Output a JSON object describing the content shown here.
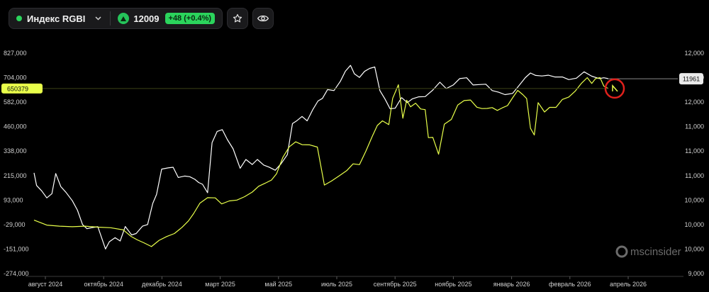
{
  "header": {
    "index_name": "Индекс RGBI",
    "price": "12009",
    "change": "+48 (+0.4%)",
    "status_color": "#2bd45c"
  },
  "icons": {
    "dropdown": "chevron-down-icon",
    "trend": "arrow-up-icon",
    "favorite": "star-icon",
    "visibility": "eye-icon"
  },
  "watermark": "mscinsider",
  "chart_data": {
    "type": "line",
    "x_labels": [
      "август 2024",
      "октябрь 2024",
      "декабрь 2024",
      "март 2025",
      "май 2025",
      "июль 2025",
      "сентябрь 2025",
      "ноябрь 2025",
      "январь 2026",
      "февраль 2026",
      "апрель 2026"
    ],
    "y_left_ticks": [
      "827,000",
      "704,000",
      "582,000",
      "460,000",
      "338,000",
      "215,000",
      "93,000",
      "-29,000",
      "-151,000",
      "-274,000"
    ],
    "y_left_range": [
      -274000,
      827000
    ],
    "y_right_ticks": [
      "12,000",
      "12,000",
      "12,000",
      "11,000",
      "11,000",
      "11,000",
      "10,000",
      "10,000",
      "10,000",
      "9,000"
    ],
    "y_right_range": [
      9000,
      12800
    ],
    "last_value_left": "650379",
    "last_value_right": "11961",
    "series": [
      {
        "color": "#ffffff",
        "axis": "left",
        "points": [
          [
            0,
            229000
          ],
          [
            0.004,
            166000
          ],
          [
            0.012,
            139000
          ],
          [
            0.02,
            104000
          ],
          [
            0.028,
            125000
          ],
          [
            0.034,
            226000
          ],
          [
            0.042,
            160000
          ],
          [
            0.05,
            132000
          ],
          [
            0.06,
            90000
          ],
          [
            0.068,
            43000
          ],
          [
            0.076,
            -29000
          ],
          [
            0.083,
            -50000
          ],
          [
            0.09,
            -45000
          ],
          [
            0.1,
            -40000
          ],
          [
            0.112,
            -151000
          ],
          [
            0.118,
            -115000
          ],
          [
            0.127,
            -95000
          ],
          [
            0.135,
            -111000
          ],
          [
            0.143,
            -39000
          ],
          [
            0.153,
            -81000
          ],
          [
            0.16,
            -74000
          ],
          [
            0.17,
            -37000
          ],
          [
            0.178,
            -29000
          ],
          [
            0.186,
            76000
          ],
          [
            0.192,
            121000
          ],
          [
            0.2,
            248000
          ],
          [
            0.21,
            254000
          ],
          [
            0.218,
            257000
          ],
          [
            0.226,
            206000
          ],
          [
            0.236,
            213000
          ],
          [
            0.244,
            210000
          ],
          [
            0.252,
            197000
          ],
          [
            0.258,
            181000
          ],
          [
            0.264,
            172000
          ],
          [
            0.272,
            130000
          ],
          [
            0.279,
            380000
          ],
          [
            0.287,
            436000
          ],
          [
            0.295,
            445000
          ],
          [
            0.303,
            395000
          ],
          [
            0.312,
            349000
          ],
          [
            0.323,
            252000
          ],
          [
            0.332,
            296000
          ],
          [
            0.342,
            271000
          ],
          [
            0.35,
            296000
          ],
          [
            0.36,
            268000
          ],
          [
            0.368,
            258000
          ],
          [
            0.378,
            242000
          ],
          [
            0.387,
            274000
          ],
          [
            0.397,
            320000
          ],
          [
            0.405,
            475000
          ],
          [
            0.412,
            490000
          ],
          [
            0.42,
            511000
          ],
          [
            0.428,
            489000
          ],
          [
            0.437,
            546000
          ],
          [
            0.445,
            588000
          ],
          [
            0.452,
            601000
          ],
          [
            0.46,
            645000
          ],
          [
            0.47,
            640000
          ],
          [
            0.48,
            686000
          ],
          [
            0.488,
            737000
          ],
          [
            0.496,
            766000
          ],
          [
            0.502,
            724000
          ],
          [
            0.51,
            706000
          ],
          [
            0.518,
            736000
          ],
          [
            0.526,
            751000
          ],
          [
            0.534,
            758000
          ],
          [
            0.542,
            640000
          ],
          [
            0.55,
            598000
          ],
          [
            0.558,
            549000
          ],
          [
            0.566,
            552000
          ],
          [
            0.576,
            605000
          ],
          [
            0.585,
            580000
          ],
          [
            0.593,
            599000
          ],
          [
            0.603,
            609000
          ],
          [
            0.613,
            610000
          ],
          [
            0.625,
            643000
          ],
          [
            0.636,
            682000
          ],
          [
            0.646,
            650000
          ],
          [
            0.657,
            668000
          ],
          [
            0.667,
            700000
          ],
          [
            0.678,
            704000
          ],
          [
            0.688,
            668000
          ],
          [
            0.698,
            670000
          ],
          [
            0.708,
            672000
          ],
          [
            0.718,
            640000
          ],
          [
            0.728,
            632000
          ],
          [
            0.738,
            620000
          ],
          [
            0.75,
            626000
          ],
          [
            0.76,
            665000
          ],
          [
            0.77,
            705000
          ],
          [
            0.778,
            728000
          ],
          [
            0.786,
            716000
          ],
          [
            0.796,
            713000
          ],
          [
            0.806,
            717000
          ],
          [
            0.816,
            708000
          ],
          [
            0.828,
            708000
          ],
          [
            0.838,
            695000
          ],
          [
            0.85,
            702000
          ],
          [
            0.862,
            734000
          ],
          [
            0.874,
            712000
          ],
          [
            0.886,
            700000
          ],
          [
            0.893,
            704000
          ],
          [
            0.898,
            701000
          ],
          [
            0.9,
            699000
          ]
        ]
      },
      {
        "color": "#e8ff4a",
        "axis": "left",
        "points": [
          [
            0,
            -7000
          ],
          [
            0.02,
            -32000
          ],
          [
            0.04,
            -37000
          ],
          [
            0.06,
            -40000
          ],
          [
            0.08,
            -37000
          ],
          [
            0.1,
            -42000
          ],
          [
            0.12,
            -45000
          ],
          [
            0.14,
            -56000
          ],
          [
            0.152,
            -88000
          ],
          [
            0.162,
            -106000
          ],
          [
            0.172,
            -120000
          ],
          [
            0.184,
            -139000
          ],
          [
            0.196,
            -108000
          ],
          [
            0.208,
            -89000
          ],
          [
            0.22,
            -74000
          ],
          [
            0.232,
            -43000
          ],
          [
            0.242,
            -11000
          ],
          [
            0.25,
            25000
          ],
          [
            0.26,
            78000
          ],
          [
            0.272,
            105000
          ],
          [
            0.284,
            104000
          ],
          [
            0.294,
            74000
          ],
          [
            0.306,
            89000
          ],
          [
            0.318,
            93000
          ],
          [
            0.33,
            110000
          ],
          [
            0.342,
            133000
          ],
          [
            0.352,
            162000
          ],
          [
            0.362,
            177000
          ],
          [
            0.372,
            193000
          ],
          [
            0.38,
            224000
          ],
          [
            0.39,
            307000
          ],
          [
            0.4,
            359000
          ],
          [
            0.41,
            384000
          ],
          [
            0.42,
            370000
          ],
          [
            0.432,
            369000
          ],
          [
            0.444,
            358000
          ],
          [
            0.455,
            168000
          ],
          [
            0.466,
            188000
          ],
          [
            0.478,
            214000
          ],
          [
            0.49,
            240000
          ],
          [
            0.5,
            274000
          ],
          [
            0.51,
            270000
          ],
          [
            0.52,
            337000
          ],
          [
            0.53,
            411000
          ],
          [
            0.538,
            466000
          ],
          [
            0.546,
            489000
          ],
          [
            0.556,
            470000
          ],
          [
            0.562,
            601000
          ],
          [
            0.571,
            669000
          ],
          [
            0.578,
            502000
          ],
          [
            0.584,
            592000
          ],
          [
            0.59,
            559000
          ],
          [
            0.598,
            577000
          ],
          [
            0.606,
            548000
          ],
          [
            0.613,
            545000
          ],
          [
            0.618,
            405000
          ],
          [
            0.625,
            406000
          ],
          [
            0.634,
            322000
          ],
          [
            0.643,
            472000
          ],
          [
            0.654,
            496000
          ],
          [
            0.664,
            568000
          ],
          [
            0.674,
            590000
          ],
          [
            0.684,
            593000
          ],
          [
            0.694,
            557000
          ],
          [
            0.702,
            550000
          ],
          [
            0.71,
            551000
          ],
          [
            0.718,
            555000
          ],
          [
            0.726,
            541000
          ],
          [
            0.734,
            554000
          ],
          [
            0.742,
            565000
          ],
          [
            0.75,
            604000
          ],
          [
            0.758,
            641000
          ],
          [
            0.766,
            620000
          ],
          [
            0.772,
            600000
          ],
          [
            0.778,
            452000
          ],
          [
            0.784,
            418000
          ],
          [
            0.79,
            580000
          ],
          [
            0.8,
            533000
          ],
          [
            0.808,
            556000
          ],
          [
            0.818,
            556000
          ],
          [
            0.828,
            596000
          ],
          [
            0.838,
            608000
          ],
          [
            0.848,
            637000
          ],
          [
            0.858,
            677000
          ],
          [
            0.867,
            705000
          ],
          [
            0.874,
            676000
          ],
          [
            0.88,
            700000
          ],
          [
            0.887,
            705000
          ],
          [
            0.893,
            662000
          ],
          [
            0.9,
            650379
          ]
        ]
      }
    ]
  }
}
